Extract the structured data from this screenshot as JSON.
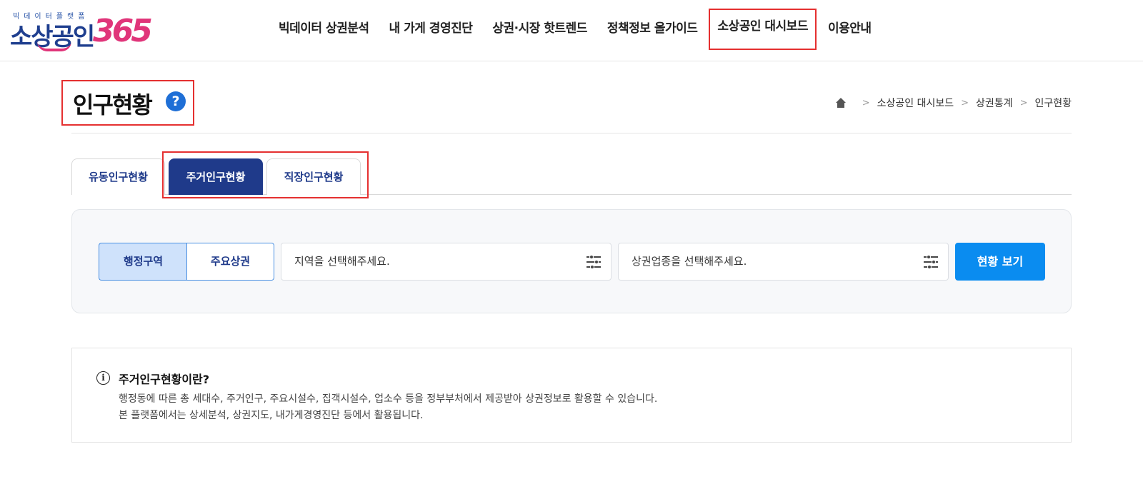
{
  "logo": {
    "subtitle": "빅데이터플랫폼",
    "name": "소상공인",
    "number": "365"
  },
  "nav": {
    "items": [
      {
        "label": "빅데이터 상권분석"
      },
      {
        "label": "내 가게 경영진단"
      },
      {
        "label": "상권·시장 핫트렌드"
      },
      {
        "label": "정책정보 올가이드"
      },
      {
        "label": "소상공인 대시보드"
      },
      {
        "label": "이용안내"
      }
    ]
  },
  "page": {
    "title": "인구현황",
    "help_glyph": "?"
  },
  "breadcrumb": {
    "items": [
      "소상공인 대시보드",
      "상권통계",
      "인구현황"
    ],
    "separator": ">"
  },
  "tabs": [
    {
      "label": "유동인구현황",
      "active": false
    },
    {
      "label": "주거인구현황",
      "active": true
    },
    {
      "label": "직장인구현황",
      "active": false
    }
  ],
  "search": {
    "area_type": {
      "left": "행정구역",
      "right": "주요상권",
      "selected": "행정구역"
    },
    "region_placeholder": "지역을 선택해주세요.",
    "business_placeholder": "상권업종을 선택해주세요.",
    "view_button": "현황 보기"
  },
  "info": {
    "icon_glyph": "i",
    "title": "주거인구현황이란?",
    "line1": "행정동에 따른 총 세대수, 주거인구, 주요시설수, 집객시설수, 업소수 등을 정부부처에서 제공받아 상권정보로 활용할 수 있습니다.",
    "line2": "본 플랫폼에서는 상세분석, 상권지도, 내가게경영진단 등에서 활용됩니다."
  },
  "colors": {
    "brand_navy": "#1f3a8a",
    "brand_pink": "#e0357a",
    "primary_button": "#0a8cf0",
    "highlight_red": "#e53030"
  }
}
